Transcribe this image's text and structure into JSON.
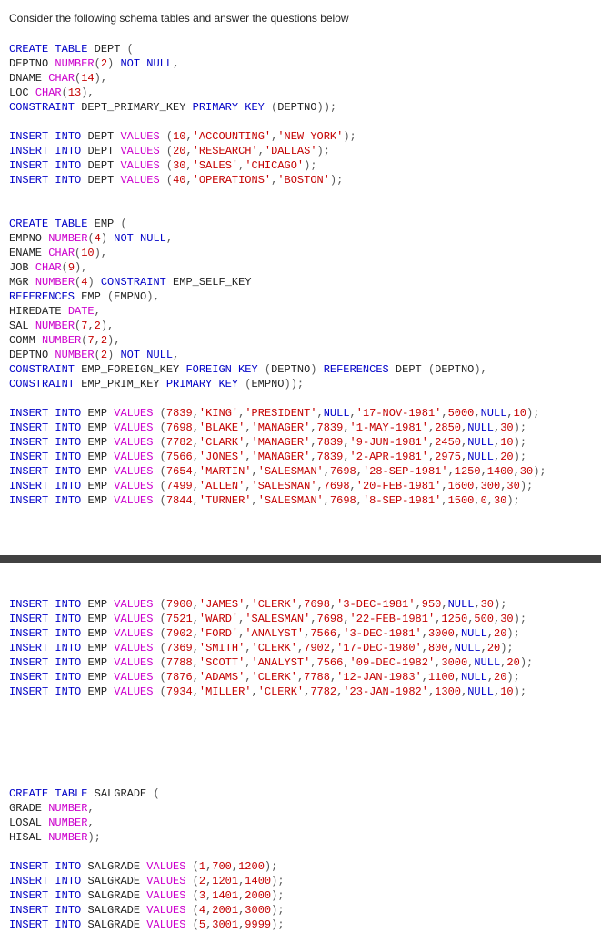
{
  "intro": "Consider the following schema tables and answer the questions below",
  "dept_create": {
    "l1_a": "CREATE",
    "l1_b": " TABLE",
    "l1_c": " DEPT ",
    "l1_p": "(",
    "l2_a": "DEPTNO ",
    "l2_b": "NUMBER",
    "l2_p1": "(",
    "l2_n": "2",
    "l2_p2": ") ",
    "l2_c": "NOT",
    "l2_d": " NULL",
    "l2_p3": ",",
    "l3_a": "DNAME ",
    "l3_b": "CHAR",
    "l3_p1": "(",
    "l3_n": "14",
    "l3_p2": "),",
    "l4_a": "LOC ",
    "l4_b": "CHAR",
    "l4_p1": "(",
    "l4_n": "13",
    "l4_p2": "),",
    "l5_a": "CONSTRAINT",
    "l5_b": " DEPT_PRIMARY_KEY ",
    "l5_c": "PRIMARY",
    "l5_d": " KEY",
    "l5_p1": " (",
    "l5_e": "DEPTNO",
    "l5_p2": "));"
  },
  "dept_ins": [
    {
      "pre": "INSERT INTO DEPT VALUES ",
      "p1": "(",
      "a": "10",
      "c1": ",",
      "b": "'ACCOUNTING'",
      "c2": ",",
      "c": "'NEW YORK'",
      "p2": ");"
    },
    {
      "pre": "INSERT INTO DEPT VALUES ",
      "p1": "(",
      "a": "20",
      "c1": ",",
      "b": "'RESEARCH'",
      "c2": ",",
      "c": "'DALLAS'",
      "p2": ");"
    },
    {
      "pre": "INSERT INTO DEPT VALUES ",
      "p1": "(",
      "a": "30",
      "c1": ",",
      "b": "'SALES'",
      "c2": ",",
      "c": "'CHICAGO'",
      "p2": ");"
    },
    {
      "pre": "INSERT INTO DEPT VALUES ",
      "p1": "(",
      "a": "40",
      "c1": ",",
      "b": "'OPERATIONS'",
      "c2": ",",
      "c": "'BOSTON'",
      "p2": ");"
    }
  ],
  "emp_create": {
    "l1_a": "CREATE",
    "l1_b": " TABLE",
    "l1_c": " EMP ",
    "l1_p": "(",
    "l2_a": "EMPNO ",
    "l2_b": "NUMBER",
    "l2_p1": "(",
    "l2_n": "4",
    "l2_p2": ") ",
    "l2_c": "NOT",
    "l2_d": " NULL",
    "l2_p3": ",",
    "l3_a": "ENAME ",
    "l3_b": "CHAR",
    "l3_p1": "(",
    "l3_n": "10",
    "l3_p2": "),",
    "l4_a": "JOB ",
    "l4_b": "CHAR",
    "l4_p1": "(",
    "l4_n": "9",
    "l4_p2": "),",
    "l5_a": "MGR ",
    "l5_b": "NUMBER",
    "l5_p1": "(",
    "l5_n": "4",
    "l5_p2": ") ",
    "l5_c": "CONSTRAINT",
    "l5_d": " EMP_SELF_KEY",
    "l6_a": "REFERENCES",
    "l6_b": " EMP ",
    "l6_p1": "(",
    "l6_c": "EMPNO",
    "l6_p2": "),",
    "l7_a": "HIREDATE ",
    "l7_b": "DATE",
    "l7_p": ",",
    "l8_a": "SAL ",
    "l8_b": "NUMBER",
    "l8_p1": "(",
    "l8_n": "7",
    "l8_c": ",",
    "l8_n2": "2",
    "l8_p2": "),",
    "l9_a": "COMM ",
    "l9_b": "NUMBER",
    "l9_p1": "(",
    "l9_n": "7",
    "l9_c": ",",
    "l9_n2": "2",
    "l9_p2": "),",
    "l10_a": "DEPTNO ",
    "l10_b": "NUMBER",
    "l10_p1": "(",
    "l10_n": "2",
    "l10_p2": ") ",
    "l10_c": "NOT",
    "l10_d": " NULL",
    "l10_p3": ",",
    "l11_a": "CONSTRAINT",
    "l11_b": " EMP_FOREIGN_KEY ",
    "l11_c": "FOREIGN",
    "l11_d": " KEY",
    "l11_p1": " (",
    "l11_e": "DEPTNO",
    "l11_p2": ") ",
    "l11_f": "REFERENCES",
    "l11_g": " DEPT ",
    "l11_p3": "(",
    "l11_h": "DEPTNO",
    "l11_p4": "),",
    "l12_a": "CONSTRAINT",
    "l12_b": " EMP_PRIM_KEY ",
    "l12_c": "PRIMARY",
    "l12_d": " KEY",
    "l12_p1": " (",
    "l12_e": "EMPNO",
    "l12_p2": "));"
  },
  "emp_ins1": [
    "INSERT INTO EMP VALUES (7839,'KING','PRESIDENT',NULL,'17-NOV-1981',5000,NULL,10);",
    "INSERT INTO EMP VALUES (7698,'BLAKE','MANAGER',7839,'1-MAY-1981',2850,NULL,30);",
    "INSERT INTO EMP VALUES (7782,'CLARK','MANAGER',7839,'9-JUN-1981',2450,NULL,10);",
    "INSERT INTO EMP VALUES (7566,'JONES','MANAGER',7839,'2-APR-1981',2975,NULL,20);",
    "INSERT INTO EMP VALUES (7654,'MARTIN','SALESMAN',7698,'28-SEP-1981',1250,1400,30);",
    "INSERT INTO EMP VALUES (7499,'ALLEN','SALESMAN',7698,'20-FEB-1981',1600,300,30);",
    "INSERT INTO EMP VALUES (7844,'TURNER','SALESMAN',7698,'8-SEP-1981',1500,0,30);"
  ],
  "emp_ins2": [
    "INSERT INTO EMP VALUES (7900,'JAMES','CLERK',7698,'3-DEC-1981',950,NULL,30);",
    "INSERT INTO EMP VALUES (7521,'WARD','SALESMAN',7698,'22-FEB-1981',1250,500,30);",
    "INSERT INTO EMP VALUES (7902,'FORD','ANALYST',7566,'3-DEC-1981',3000,NULL,20);",
    "INSERT INTO EMP VALUES (7369,'SMITH','CLERK',7902,'17-DEC-1980',800,NULL,20);",
    "INSERT INTO EMP VALUES (7788,'SCOTT','ANALYST',7566,'09-DEC-1982',3000,NULL,20);",
    "INSERT INTO EMP VALUES (7876,'ADAMS','CLERK',7788,'12-JAN-1983',1100,NULL,20);",
    "INSERT INTO EMP VALUES (7934,'MILLER','CLERK',7782,'23-JAN-1982',1300,NULL,10);"
  ],
  "sal_create": {
    "l1_a": "CREATE",
    "l1_b": " TABLE",
    "l1_c": " SALGRADE ",
    "l1_p": "(",
    "l2_a": "GRADE ",
    "l2_b": "NUMBER",
    "l2_p": ",",
    "l3_a": "LOSAL ",
    "l3_b": "NUMBER",
    "l3_p": ",",
    "l4_a": "HISAL ",
    "l4_b": "NUMBER",
    "l4_p": ");"
  },
  "sal_ins": [
    "INSERT INTO SALGRADE VALUES (1,700,1200);",
    "INSERT INTO SALGRADE VALUES (2,1201,1400);",
    "INSERT INTO SALGRADE VALUES (3,1401,2000);",
    "INSERT INTO SALGRADE VALUES (4,2001,3000);",
    "INSERT INTO SALGRADE VALUES (5,3001,9999);"
  ]
}
